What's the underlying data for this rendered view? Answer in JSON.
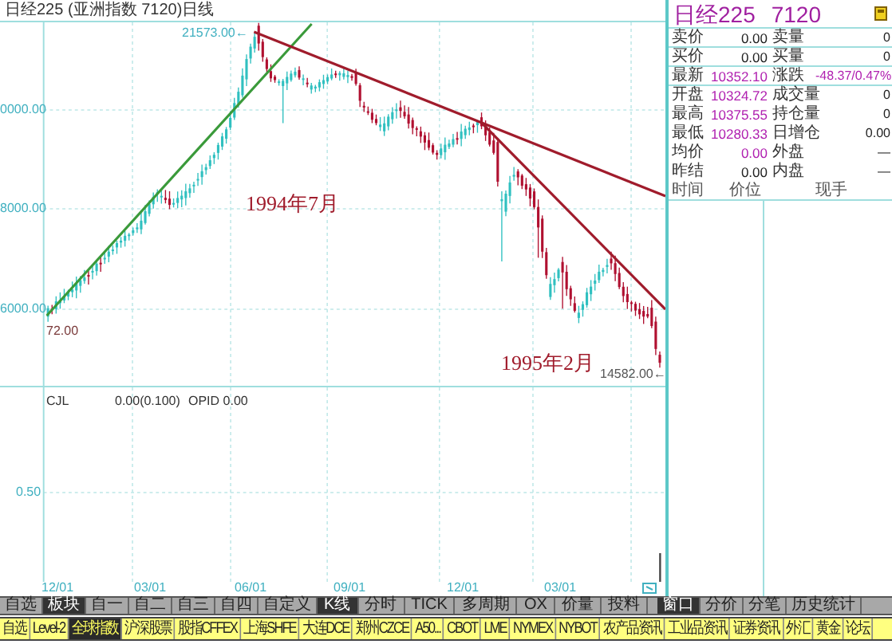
{
  "window": {
    "title": "日经225 (亚洲指数 7120)日线"
  },
  "price_chart": {
    "axis_labels": [
      "0000.00",
      "8000.00",
      "6000.00"
    ],
    "high_label": "21573.00←",
    "low_label": "14582.00←",
    "start_label": "72.00",
    "annotations": [
      "1994年7月",
      "1995年2月"
    ]
  },
  "volume_chart": {
    "indicator": "CJL",
    "value": "0.00(0.100)",
    "opid": "OPID 0.00",
    "axis_label": "0.50"
  },
  "time_axis": [
    "12/01",
    "03/01",
    "06/01",
    "09/01",
    "12/01",
    "03/01"
  ],
  "quote": {
    "name": "日经225",
    "code": "7120",
    "rows": [
      {
        "label": "卖价",
        "value": "0.00",
        "value_accent": false,
        "label2": "卖量",
        "value2": "0",
        "value2_accent": false
      },
      {
        "label": "买价",
        "value": "0.00",
        "value_accent": false,
        "label2": "买量",
        "value2": "0",
        "value2_accent": false
      },
      {
        "label": "最新",
        "value": "10352.10",
        "value_accent": true,
        "label2": "涨跌",
        "value2": "-48.37/0.47%",
        "value2_accent": true
      },
      {
        "label": "开盘",
        "value": "10324.72",
        "value_accent": true,
        "label2": "成交量",
        "value2": "0",
        "value2_accent": false
      },
      {
        "label": "最高",
        "value": "10375.55",
        "value_accent": true,
        "label2": "持仓量",
        "value2": "0",
        "value2_accent": false
      },
      {
        "label": "最低",
        "value": "10280.33",
        "value_accent": true,
        "label2": "日增仓",
        "value2": "0.00",
        "value2_accent": false
      },
      {
        "label": "均价",
        "value": "0.00",
        "value_accent": true,
        "label2": "外盘",
        "value2": "—",
        "value2_accent": false
      },
      {
        "label": "昨结",
        "value": "0.00",
        "value_accent": false,
        "label2": "内盘",
        "value2": "—",
        "value2_accent": false
      }
    ],
    "columns": [
      "时间",
      "价位",
      "现手"
    ]
  },
  "group_tabs": [
    {
      "label": "自选",
      "selected": false
    },
    {
      "label": "板块",
      "selected": true
    },
    {
      "label": "自一",
      "selected": false
    },
    {
      "label": "自二",
      "selected": false
    },
    {
      "label": "自三",
      "selected": false
    },
    {
      "label": "自四",
      "selected": false
    },
    {
      "label": "自定义",
      "selected": false
    }
  ],
  "view_tabs": [
    {
      "label": "K线",
      "selected": true
    },
    {
      "label": "分时",
      "selected": false
    },
    {
      "label": "TICK",
      "selected": false
    },
    {
      "label": "多周期",
      "selected": false
    },
    {
      "label": "OX",
      "selected": false
    },
    {
      "label": "价量",
      "selected": false
    },
    {
      "label": "投料",
      "selected": false
    }
  ],
  "window_tabs": [
    {
      "label": "窗口",
      "selected": true
    },
    {
      "label": "分价",
      "selected": false
    },
    {
      "label": "分笔",
      "selected": false
    },
    {
      "label": "历史统计",
      "selected": false
    }
  ],
  "market_tabs": [
    {
      "label": "自选",
      "selected": false
    },
    {
      "label": "Level-2",
      "selected": false
    },
    {
      "label": "全球指数",
      "selected": true
    },
    {
      "label": "沪深股票",
      "selected": false
    },
    {
      "label": "股指CFFEX",
      "selected": false
    },
    {
      "label": "上海SHFE",
      "selected": false
    },
    {
      "label": "大连DCE",
      "selected": false
    },
    {
      "label": "郑州CZCE",
      "selected": false
    },
    {
      "label": "A50...",
      "selected": false
    },
    {
      "label": "CBOT",
      "selected": false
    },
    {
      "label": "LME",
      "selected": false
    },
    {
      "label": "NYMEX",
      "selected": false
    },
    {
      "label": "NYBOT",
      "selected": false
    },
    {
      "label": "农产品资讯",
      "selected": false
    },
    {
      "label": "工业品资讯",
      "selected": false
    },
    {
      "label": "证券资讯",
      "selected": false
    },
    {
      "label": "外汇",
      "selected": false
    },
    {
      "label": "黄金",
      "selected": false
    },
    {
      "label": "论坛",
      "selected": false
    }
  ]
}
